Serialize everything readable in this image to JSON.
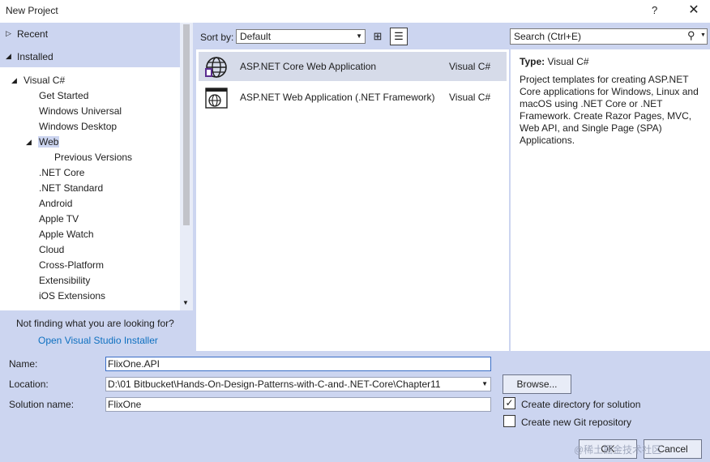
{
  "window": {
    "title": "New Project",
    "help": "?",
    "close": "✕"
  },
  "sidebar": {
    "recent": "Recent",
    "installed": "Installed",
    "tree": [
      {
        "label": "Visual C#",
        "level": 0,
        "expanded": true
      },
      {
        "label": "Get Started",
        "level": 1
      },
      {
        "label": "Windows Universal",
        "level": 1
      },
      {
        "label": "Windows Desktop",
        "level": 1
      },
      {
        "label": "Web",
        "level": 1,
        "expanded": true,
        "selected": true
      },
      {
        "label": "Previous Versions",
        "level": 2
      },
      {
        "label": ".NET Core",
        "level": 1
      },
      {
        "label": ".NET Standard",
        "level": 1
      },
      {
        "label": "Android",
        "level": 1
      },
      {
        "label": "Apple TV",
        "level": 1
      },
      {
        "label": "Apple Watch",
        "level": 1
      },
      {
        "label": "Cloud",
        "level": 1
      },
      {
        "label": "Cross-Platform",
        "level": 1
      },
      {
        "label": "Extensibility",
        "level": 1
      },
      {
        "label": "iOS Extensions",
        "level": 1
      }
    ],
    "not_finding": "Not finding what you are looking for?",
    "installer_link": "Open Visual Studio Installer"
  },
  "sort": {
    "label": "Sort by:",
    "value": "Default"
  },
  "templates": [
    {
      "name": "ASP.NET Core Web Application",
      "lang": "Visual C#",
      "selected": true,
      "icon": "aspnet-core-globe-icon"
    },
    {
      "name": "ASP.NET Web Application (.NET Framework)",
      "lang": "Visual C#",
      "selected": false,
      "icon": "aspnet-framework-globe-icon"
    }
  ],
  "search": {
    "placeholder": "Search (Ctrl+E)"
  },
  "details": {
    "type_label": "Type:",
    "type_value": "Visual C#",
    "description": "Project templates for creating ASP.NET Core applications for Windows, Linux and macOS using .NET Core or .NET Framework. Create Razor Pages, MVC, Web API, and Single Page (SPA) Applications."
  },
  "form": {
    "name_label": "Name:",
    "name_value": "FlixOne.API",
    "location_label": "Location:",
    "location_value": "D:\\01 Bitbucket\\Hands-On-Design-Patterns-with-C-and-.NET-Core\\Chapter11",
    "solution_label": "Solution name:",
    "solution_value": "FlixOne",
    "browse": "Browse...",
    "create_dir_label": "Create directory for solution",
    "create_dir_checked": true,
    "create_git_label": "Create new Git repository",
    "create_git_checked": false,
    "ok": "OK",
    "cancel": "Cancel"
  },
  "watermark": "@稀土掘金技术社区"
}
